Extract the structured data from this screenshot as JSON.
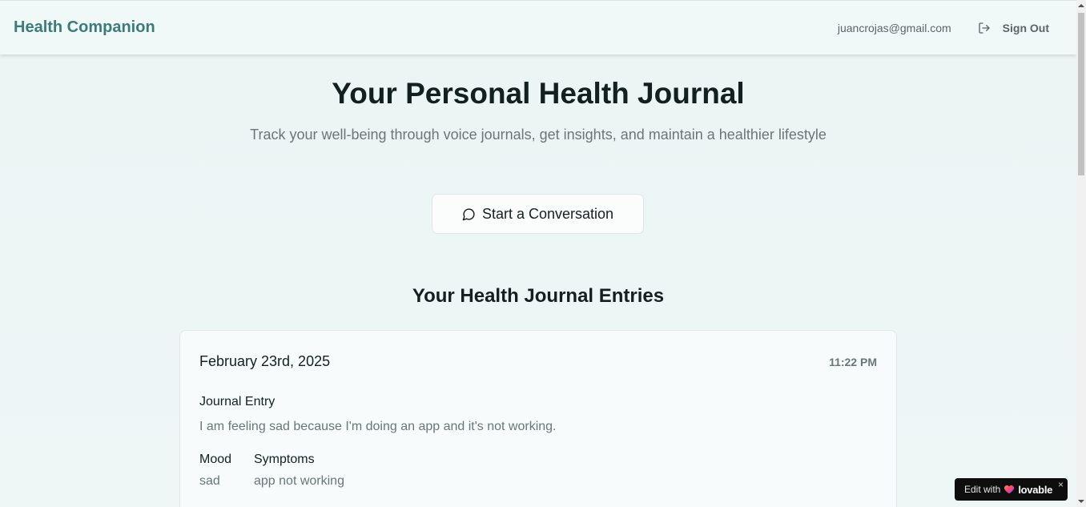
{
  "header": {
    "brand": "Health Companion",
    "user_email": "juancrojas@gmail.com",
    "sign_out_label": "Sign Out"
  },
  "hero": {
    "title": "Your Personal Health Journal",
    "subtitle": "Track your well-being through voice journals, get insights, and maintain a healthier lifestyle",
    "cta_label": "Start a Conversation"
  },
  "entries_section": {
    "title": "Your Health Journal Entries",
    "entries": [
      {
        "date": "February 23rd, 2025",
        "time": "11:22 PM",
        "label": "Journal Entry",
        "text": "I am feeling sad because I'm doing an app and it's not working.",
        "mood_label": "Mood",
        "mood_value": "sad",
        "symptoms_label": "Symptoms",
        "symptoms_value": "app not working"
      }
    ]
  },
  "badge": {
    "edit_label": "Edit with",
    "brand": "lovable",
    "close": "×"
  },
  "colors": {
    "brand": "#3a7d78",
    "background": "#eaf5f4",
    "text": "#142020",
    "muted": "#6b7676"
  },
  "icons": {
    "sign_out": "log-out-icon",
    "cta": "message-circle-icon",
    "badge_heart": "heart-icon"
  }
}
